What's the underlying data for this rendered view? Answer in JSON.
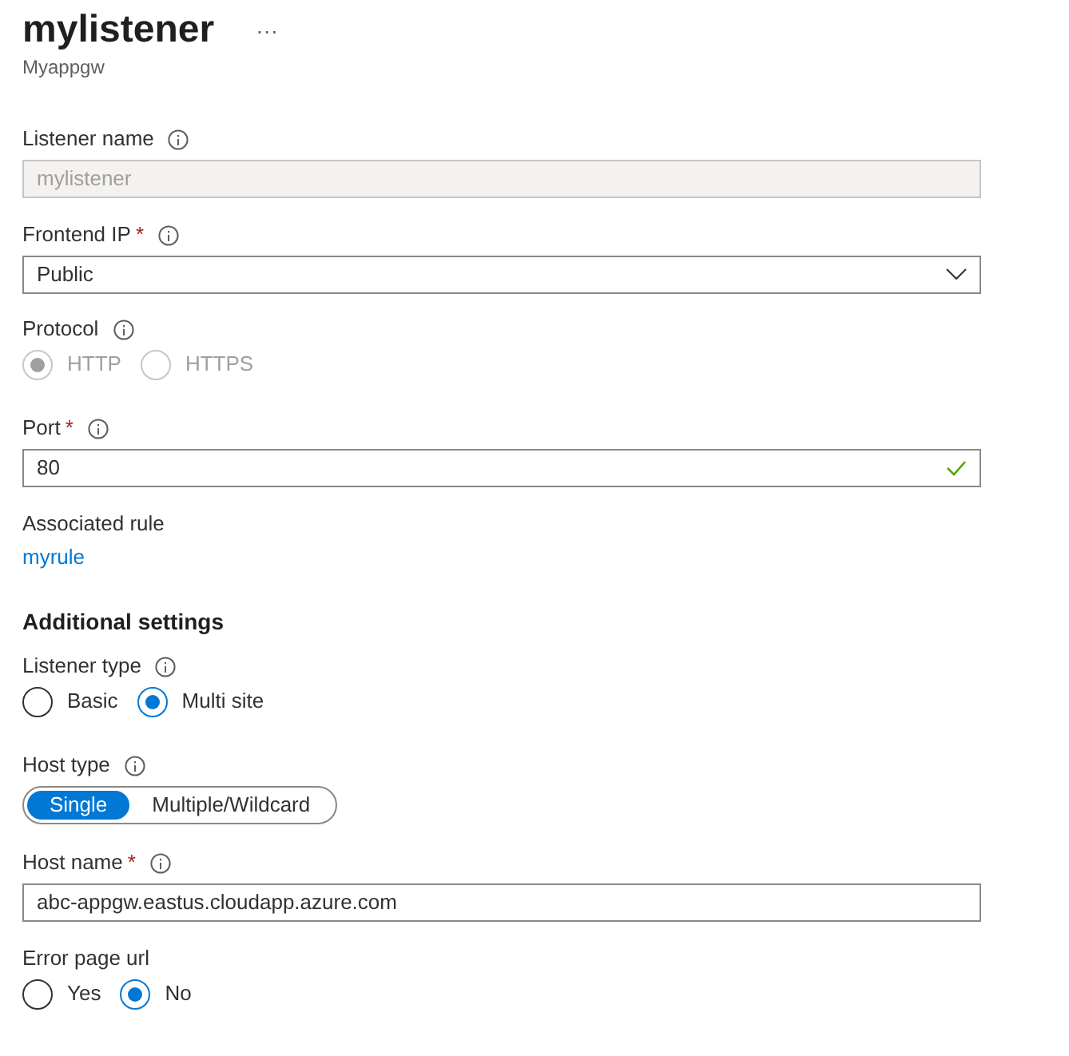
{
  "header": {
    "title": "mylistener",
    "more": "···",
    "subtitle": "Myappgw"
  },
  "fields": [
    {
      "kind": "text",
      "label": "Listener name",
      "info": true,
      "value": "mylistener",
      "disabled": true,
      "valid": false
    },
    {
      "kind": "dropdown",
      "label": "Frontend IP",
      "required_mark": "*",
      "info": true,
      "value": "Public"
    },
    {
      "kind": "radio",
      "label": "Protocol",
      "info": true,
      "disabled": true,
      "options": [
        {
          "label": "HTTP",
          "selected": true
        },
        {
          "label": "HTTPS",
          "selected": false
        }
      ]
    },
    {
      "kind": "text",
      "label": "Port",
      "required_mark": "*",
      "info": true,
      "value": "80",
      "disabled": false,
      "valid": true
    },
    {
      "kind": "link",
      "label": "Associated rule",
      "info": false,
      "value": "myrule"
    },
    {
      "kind": "heading",
      "label": "Additional settings"
    },
    {
      "kind": "radio",
      "label": "Listener type",
      "info": true,
      "disabled": false,
      "options": [
        {
          "label": "Basic",
          "selected": false
        },
        {
          "label": "Multi site",
          "selected": true
        }
      ]
    },
    {
      "kind": "toggle",
      "label": "Host type",
      "info": true,
      "options": [
        {
          "label": "Single",
          "selected": true
        },
        {
          "label": "Multiple/Wildcard",
          "selected": false
        }
      ]
    },
    {
      "kind": "text",
      "label": "Host name",
      "required_mark": "*",
      "info": true,
      "value": "abc-appgw.eastus.cloudapp.azure.com",
      "disabled": false,
      "valid": false
    },
    {
      "kind": "radio",
      "label": "Error page url",
      "info": false,
      "disabled": false,
      "options": [
        {
          "label": "Yes",
          "selected": false
        },
        {
          "label": "No",
          "selected": true
        }
      ]
    }
  ]
}
